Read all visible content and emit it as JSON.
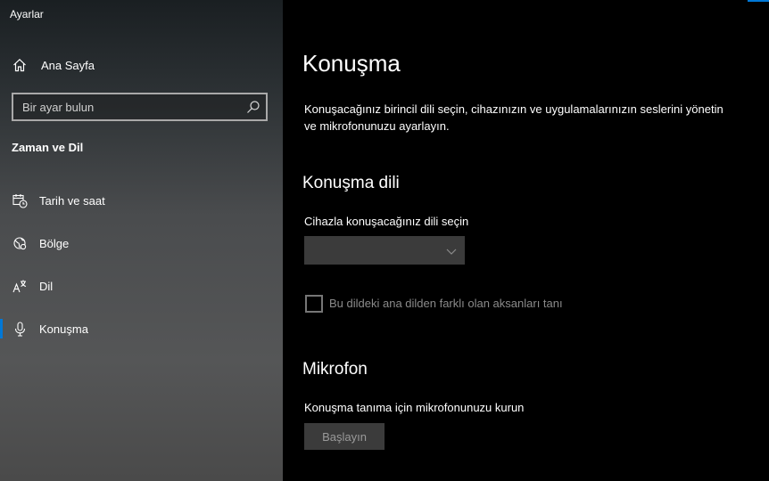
{
  "window": {
    "title": "Ayarlar"
  },
  "sidebar": {
    "home_label": "Ana Sayfa",
    "search_placeholder": "Bir ayar bulun",
    "section_title": "Zaman ve Dil",
    "items": [
      {
        "label": "Tarih ve saat",
        "icon": "calendar-clock-icon"
      },
      {
        "label": "Bölge",
        "icon": "globe-icon"
      },
      {
        "label": "Dil",
        "icon": "language-icon"
      },
      {
        "label": "Konuşma",
        "icon": "microphone-icon",
        "active": true
      }
    ]
  },
  "main": {
    "title": "Konuşma",
    "description": "Konuşacağınız birincil dili seçin, cihazınızın ve uygulamalarınızın seslerini yönetin ve mikrofonunuzu ayarlayın.",
    "speech_language": {
      "heading": "Konuşma dili",
      "select_label": "Cihazla konuşacağınız dili seçin",
      "selected_value": "",
      "checkbox_label": "Bu dildeki ana dilden farklı olan aksanları tanı",
      "checkbox_checked": false
    },
    "microphone": {
      "heading": "Mikrofon",
      "label": "Konuşma tanıma için mikrofonunuzu kurun",
      "button_label": "Başlayın"
    }
  },
  "colors": {
    "accent": "#0078d7",
    "disabled_text": "#8a8a8a",
    "control_bg": "#3b3b3b"
  }
}
